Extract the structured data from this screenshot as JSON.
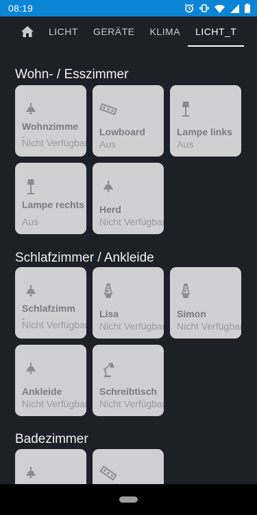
{
  "statusbar": {
    "time": "08:19",
    "bg": "#0a84d4"
  },
  "tabs": [
    {
      "label": "",
      "icon": "home-icon",
      "active": false
    },
    {
      "label": "LICHT",
      "active": false
    },
    {
      "label": "GERÄTE",
      "active": false
    },
    {
      "label": "KLIMA",
      "active": false
    },
    {
      "label": "LICHT_T",
      "active": true
    }
  ],
  "sections": [
    {
      "title": "Wohn- / Esszimmer",
      "cards": [
        {
          "name": "Wohnzimme",
          "state": "Nicht Verfügbar",
          "icon": "ceiling-lamp-icon"
        },
        {
          "name": "Lowboard",
          "state": "Aus",
          "icon": "led-strip-icon"
        },
        {
          "name": "Lampe links",
          "state": "Aus",
          "icon": "floor-lamp-icon"
        },
        {
          "name": "Lampe rechts",
          "state": "Aus",
          "icon": "floor-lamp-icon"
        },
        {
          "name": "Herd",
          "state": "Nicht Verfügbar",
          "icon": "ceiling-lamp-icon"
        }
      ]
    },
    {
      "title": "Schlafzimmer / Ankleide",
      "cards": [
        {
          "name": "Schlafzimm",
          "state": "Nicht Verfügbar",
          "icon": "ceiling-lamp-icon"
        },
        {
          "name": "Lisa",
          "state": "Nicht Verfügbar",
          "icon": "lava-lamp-icon"
        },
        {
          "name": "Simon",
          "state": "Nicht Verfügbar",
          "icon": "lava-lamp-icon"
        },
        {
          "name": "Ankleide",
          "state": "Nicht Verfügbar",
          "icon": "ceiling-lamp-icon"
        },
        {
          "name": "Schreibtisch",
          "state": "Nicht Verfügbar",
          "icon": "desk-lamp-icon"
        }
      ]
    },
    {
      "title": "Badezimmer",
      "cards": [
        {
          "name": "",
          "state": "",
          "icon": "ceiling-lamp-icon"
        },
        {
          "name": "",
          "state": "",
          "icon": "led-strip-icon"
        }
      ]
    }
  ]
}
